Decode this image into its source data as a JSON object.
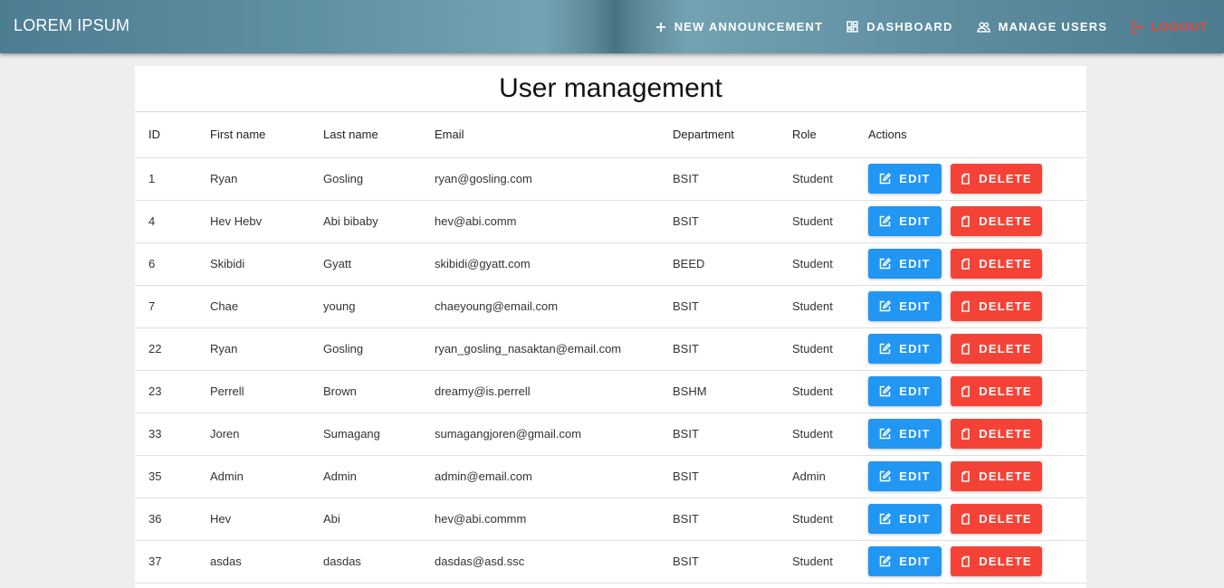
{
  "header": {
    "brand": "LOREM IPSUM",
    "nav": {
      "new_announcement": "NEW ANNOUNCEMENT",
      "dashboard": "DASHBOARD",
      "manage_users": "MANAGE USERS",
      "logout": "LOGOUT"
    }
  },
  "page": {
    "title": "User management"
  },
  "table": {
    "columns": {
      "id": "ID",
      "first_name": "First name",
      "last_name": "Last name",
      "email": "Email",
      "department": "Department",
      "role": "Role",
      "actions": "Actions"
    },
    "edit_label": "EDIT",
    "delete_label": "DELETE",
    "rows": [
      {
        "id": "1",
        "first_name": "Ryan",
        "last_name": "Gosling",
        "email": "ryan@gosling.com",
        "department": "BSIT",
        "role": "Student"
      },
      {
        "id": "4",
        "first_name": "Hev Hebv",
        "last_name": "Abi bibaby",
        "email": "hev@abi.comm",
        "department": "BSIT",
        "role": "Student"
      },
      {
        "id": "6",
        "first_name": "Skibidi",
        "last_name": "Gyatt",
        "email": "skibidi@gyatt.com",
        "department": "BEED",
        "role": "Student"
      },
      {
        "id": "7",
        "first_name": "Chae",
        "last_name": "young",
        "email": "chaeyoung@email.com",
        "department": "BSIT",
        "role": "Student"
      },
      {
        "id": "22",
        "first_name": "Ryan",
        "last_name": "Gosling",
        "email": "ryan_gosling_nasaktan@email.com",
        "department": "BSIT",
        "role": "Student"
      },
      {
        "id": "23",
        "first_name": "Perrell",
        "last_name": "Brown",
        "email": "dreamy@is.perrell",
        "department": "BSHM",
        "role": "Student"
      },
      {
        "id": "33",
        "first_name": "Joren",
        "last_name": "Sumagang",
        "email": "sumagangjoren@gmail.com",
        "department": "BSIT",
        "role": "Student"
      },
      {
        "id": "35",
        "first_name": "Admin",
        "last_name": "Admin",
        "email": "admin@email.com",
        "department": "BSIT",
        "role": "Admin"
      },
      {
        "id": "36",
        "first_name": "Hev",
        "last_name": "Abi",
        "email": "hev@abi.commm",
        "department": "BSIT",
        "role": "Student"
      },
      {
        "id": "37",
        "first_name": "asdas",
        "last_name": "dasdas",
        "email": "dasdas@asd.ssc",
        "department": "BSIT",
        "role": "Student"
      }
    ]
  },
  "colors": {
    "edit_button": "#2196f3",
    "delete_button": "#f44336",
    "logout": "#f44336"
  }
}
